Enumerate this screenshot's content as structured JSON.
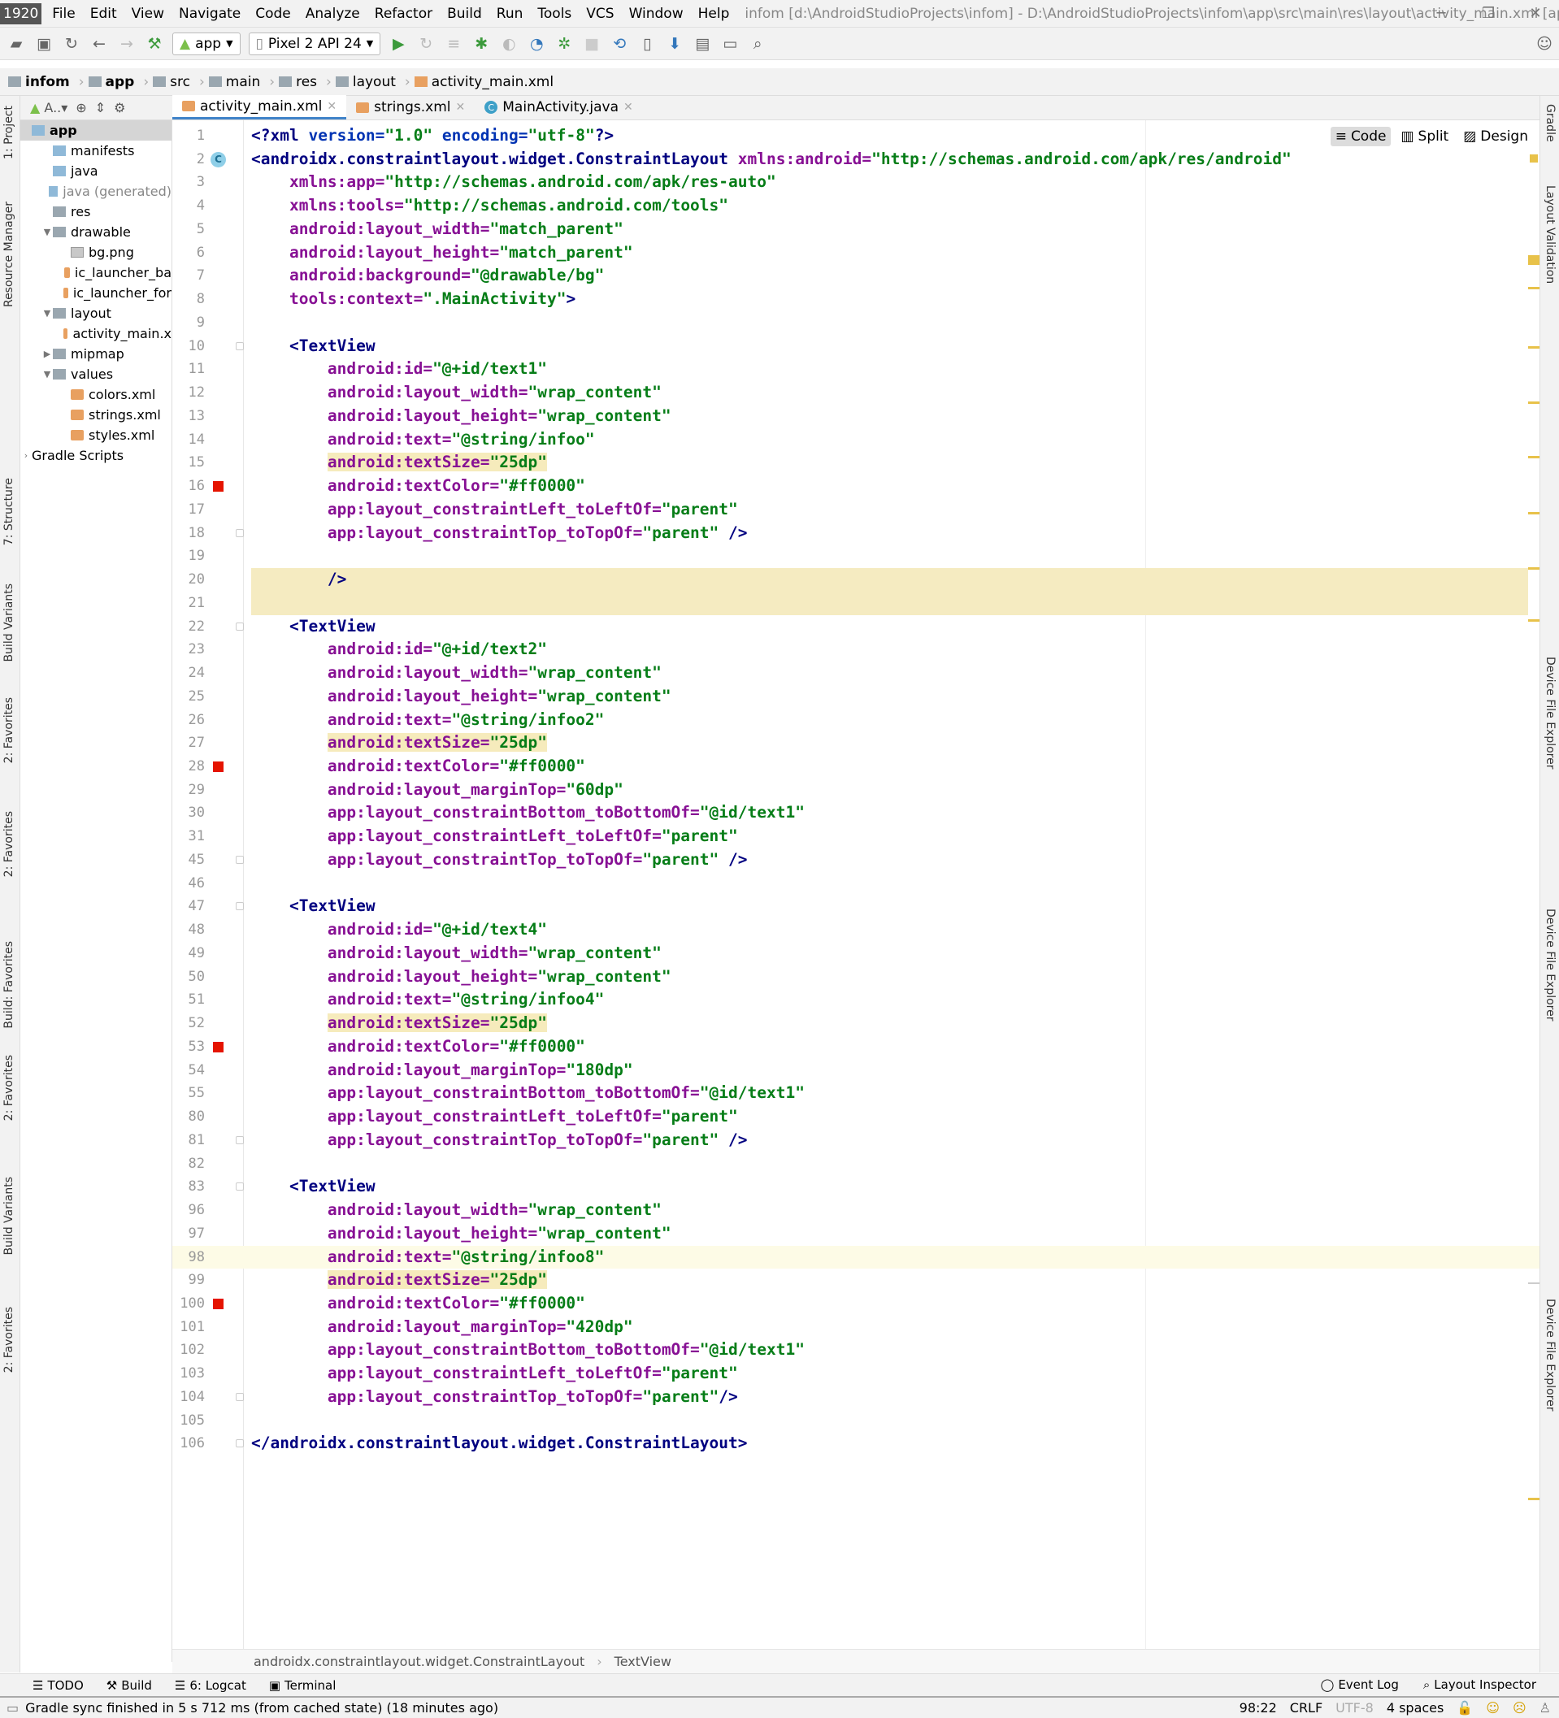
{
  "resolution_badge": "1920 × 1030",
  "menu": [
    "File",
    "Edit",
    "View",
    "Navigate",
    "Code",
    "Analyze",
    "Refactor",
    "Build",
    "Run",
    "Tools",
    "VCS",
    "Window",
    "Help"
  ],
  "window_title": "infom [d:\\AndroidStudioProjects\\infom] - D:\\AndroidStudioProjects\\infom\\app\\src\\main\\res\\layout\\activity_main.xml [app]",
  "toolbar": {
    "run_config": "app",
    "device": "Pixel 2 API 24"
  },
  "breadcrumb": [
    "infom",
    "app",
    "src",
    "main",
    "res",
    "layout",
    "activity_main.xml"
  ],
  "left_strip": [
    "1: Project",
    "Resource Manager",
    "7: Structure",
    "Build Variants",
    "2: Favorites",
    "2: Favorites",
    "Build: Favorites",
    "2: Favorites",
    "Build Variants",
    "2: Favorites"
  ],
  "right_strip": [
    "Gradle",
    "Layout Validation",
    "Device File Explorer",
    "Device File Explorer",
    "Device File Explorer"
  ],
  "project_panel": {
    "selector": "A..",
    "items": [
      {
        "label": "app",
        "level": 0,
        "icon": "folder",
        "arrow": "",
        "sel": true
      },
      {
        "label": "manifests",
        "level": 1,
        "icon": "folder",
        "arrow": ""
      },
      {
        "label": "java",
        "level": 1,
        "icon": "folder",
        "arrow": ""
      },
      {
        "label": "java (generated)",
        "level": 1,
        "icon": "folder",
        "arrow": "",
        "gen": true
      },
      {
        "label": "res",
        "level": 1,
        "icon": "gfolder",
        "arrow": ""
      },
      {
        "label": "drawable",
        "level": 1,
        "icon": "gfolder",
        "arrow": "▼"
      },
      {
        "label": "bg.png",
        "level": 2,
        "icon": "png",
        "arrow": ""
      },
      {
        "label": "ic_launcher_ba",
        "level": 2,
        "icon": "xml",
        "arrow": ""
      },
      {
        "label": "ic_launcher_for",
        "level": 2,
        "icon": "xml",
        "arrow": ""
      },
      {
        "label": "layout",
        "level": 1,
        "icon": "gfolder",
        "arrow": "▼"
      },
      {
        "label": "activity_main.x",
        "level": 2,
        "icon": "xml",
        "arrow": ""
      },
      {
        "label": "mipmap",
        "level": 1,
        "icon": "gfolder",
        "arrow": "▶"
      },
      {
        "label": "values",
        "level": 1,
        "icon": "gfolder",
        "arrow": "▼"
      },
      {
        "label": "colors.xml",
        "level": 2,
        "icon": "xml",
        "arrow": ""
      },
      {
        "label": "strings.xml",
        "level": 2,
        "icon": "xml",
        "arrow": ""
      },
      {
        "label": "styles.xml",
        "level": 2,
        "icon": "xml",
        "arrow": ""
      },
      {
        "label": "Gradle Scripts",
        "level": 0,
        "icon": "",
        "arrow": "›"
      }
    ]
  },
  "tabs": [
    {
      "label": "activity_main.xml",
      "icon": "xml",
      "active": true
    },
    {
      "label": "strings.xml",
      "icon": "xml",
      "active": false
    },
    {
      "label": "MainActivity.java",
      "icon": "class",
      "active": false
    }
  ],
  "view_modes": [
    "Code",
    "Split",
    "Design"
  ],
  "code_lines": [
    {
      "n": "1",
      "t": [
        [
          "tg",
          "<?xml "
        ],
        [
          "at2",
          "version="
        ],
        [
          "vl",
          "\"1.0\" "
        ],
        [
          "at2",
          "encoding="
        ],
        [
          "vl",
          "\"utf-8\""
        ],
        [
          "tg",
          "?>"
        ]
      ]
    },
    {
      "n": "2",
      "m": "c",
      "t": [
        [
          "tg",
          "<androidx.constraintlayout.widget.ConstraintLayout "
        ],
        [
          "at",
          "xmlns:android="
        ],
        [
          "vl",
          "\"http://schemas.android.com/apk/res/android\""
        ]
      ]
    },
    {
      "n": "3",
      "t": [
        [
          "pl",
          "    "
        ],
        [
          "at",
          "xmlns:app="
        ],
        [
          "vl",
          "\"http://schemas.android.com/apk/res-auto\""
        ]
      ]
    },
    {
      "n": "4",
      "t": [
        [
          "pl",
          "    "
        ],
        [
          "at",
          "xmlns:tools="
        ],
        [
          "vl",
          "\"http://schemas.android.com/tools\""
        ]
      ]
    },
    {
      "n": "5",
      "t": [
        [
          "pl",
          "    "
        ],
        [
          "at",
          "android:layout_width="
        ],
        [
          "vl",
          "\"match_parent\""
        ]
      ]
    },
    {
      "n": "6",
      "t": [
        [
          "pl",
          "    "
        ],
        [
          "at",
          "android:layout_height="
        ],
        [
          "vl",
          "\"match_parent\""
        ]
      ]
    },
    {
      "n": "7",
      "t": [
        [
          "pl",
          "    "
        ],
        [
          "at",
          "android:background="
        ],
        [
          "vl",
          "\"@drawable/bg\""
        ]
      ]
    },
    {
      "n": "8",
      "t": [
        [
          "pl",
          "    "
        ],
        [
          "at",
          "tools:context="
        ],
        [
          "vl",
          "\".MainActivity\""
        ],
        [
          "tg",
          ">"
        ]
      ]
    },
    {
      "n": "9",
      "t": []
    },
    {
      "n": "10",
      "f": 1,
      "t": [
        [
          "pl",
          "    "
        ],
        [
          "tg",
          "<TextView"
        ]
      ]
    },
    {
      "n": "11",
      "t": [
        [
          "pl",
          "        "
        ],
        [
          "at",
          "android:id="
        ],
        [
          "vl",
          "\"@+id/text1\""
        ]
      ]
    },
    {
      "n": "12",
      "t": [
        [
          "pl",
          "        "
        ],
        [
          "at",
          "android:layout_width="
        ],
        [
          "vl",
          "\"wrap_content\""
        ]
      ]
    },
    {
      "n": "13",
      "t": [
        [
          "pl",
          "        "
        ],
        [
          "at",
          "android:layout_height="
        ],
        [
          "vl",
          "\"wrap_content\""
        ]
      ]
    },
    {
      "n": "14",
      "t": [
        [
          "pl",
          "        "
        ],
        [
          "at",
          "android:text="
        ],
        [
          "vl",
          "\"@string/infoo\""
        ]
      ]
    },
    {
      "n": "15",
      "h": 1,
      "t": [
        [
          "pl",
          "        "
        ],
        [
          "at",
          "android:textSize="
        ],
        [
          "vl",
          "\"25dp\""
        ]
      ]
    },
    {
      "n": "16",
      "m": "r",
      "t": [
        [
          "pl",
          "        "
        ],
        [
          "at",
          "android:textColor="
        ],
        [
          "vl",
          "\"#ff0000\""
        ]
      ]
    },
    {
      "n": "17",
      "t": [
        [
          "pl",
          "        "
        ],
        [
          "at",
          "app:layout_constraintLeft_toLeftOf="
        ],
        [
          "vl",
          "\"parent\""
        ]
      ]
    },
    {
      "n": "18",
      "f": 1,
      "t": [
        [
          "pl",
          "        "
        ],
        [
          "at",
          "app:layout_constraintTop_toTopOf="
        ],
        [
          "vl",
          "\"parent\""
        ],
        [
          "tg",
          " />"
        ]
      ]
    },
    {
      "n": "19",
      "t": []
    },
    {
      "n": "20",
      "b": 1,
      "t": [
        [
          "pl",
          "        "
        ],
        [
          "tg",
          "/>"
        ]
      ]
    },
    {
      "n": "21",
      "b": 1,
      "t": []
    },
    {
      "n": "22",
      "f": 1,
      "t": [
        [
          "pl",
          "    "
        ],
        [
          "tg",
          "<TextView"
        ]
      ]
    },
    {
      "n": "23",
      "t": [
        [
          "pl",
          "        "
        ],
        [
          "at",
          "android:id="
        ],
        [
          "vl",
          "\"@+id/text2\""
        ]
      ]
    },
    {
      "n": "24",
      "t": [
        [
          "pl",
          "        "
        ],
        [
          "at",
          "android:layout_width="
        ],
        [
          "vl",
          "\"wrap_content\""
        ]
      ]
    },
    {
      "n": "25",
      "t": [
        [
          "pl",
          "        "
        ],
        [
          "at",
          "android:layout_height="
        ],
        [
          "vl",
          "\"wrap_content\""
        ]
      ]
    },
    {
      "n": "26",
      "t": [
        [
          "pl",
          "        "
        ],
        [
          "at",
          "android:text="
        ],
        [
          "vl",
          "\"@string/infoo2\""
        ]
      ]
    },
    {
      "n": "27",
      "h": 1,
      "t": [
        [
          "pl",
          "        "
        ],
        [
          "at",
          "android:textSize="
        ],
        [
          "vl",
          "\"25dp\""
        ]
      ]
    },
    {
      "n": "28",
      "m": "r",
      "t": [
        [
          "pl",
          "        "
        ],
        [
          "at",
          "android:textColor="
        ],
        [
          "vl",
          "\"#ff0000\""
        ]
      ]
    },
    {
      "n": "29",
      "t": [
        [
          "pl",
          "        "
        ],
        [
          "at",
          "android:layout_marginTop="
        ],
        [
          "vl",
          "\"60dp\""
        ]
      ]
    },
    {
      "n": "30",
      "t": [
        [
          "pl",
          "        "
        ],
        [
          "at",
          "app:layout_constraintBottom_toBottomOf="
        ],
        [
          "vl",
          "\"@id/text1\""
        ]
      ]
    },
    {
      "n": "31",
      "t": [
        [
          "pl",
          "        "
        ],
        [
          "at",
          "app:layout_constraintLeft_toLeftOf="
        ],
        [
          "vl",
          "\"parent\""
        ]
      ]
    },
    {
      "n": "45",
      "f": 1,
      "t": [
        [
          "pl",
          "        "
        ],
        [
          "at",
          "app:layout_constraintTop_toTopOf="
        ],
        [
          "vl",
          "\"parent\""
        ],
        [
          "tg",
          " />"
        ]
      ]
    },
    {
      "n": "46",
      "t": []
    },
    {
      "n": "47",
      "f": 1,
      "t": [
        [
          "pl",
          "    "
        ],
        [
          "tg",
          "<TextView"
        ]
      ]
    },
    {
      "n": "48",
      "t": [
        [
          "pl",
          "        "
        ],
        [
          "at",
          "android:id="
        ],
        [
          "vl",
          "\"@+id/text4\""
        ]
      ]
    },
    {
      "n": "49",
      "t": [
        [
          "pl",
          "        "
        ],
        [
          "at",
          "android:layout_width="
        ],
        [
          "vl",
          "\"wrap_content\""
        ]
      ]
    },
    {
      "n": "50",
      "t": [
        [
          "pl",
          "        "
        ],
        [
          "at",
          "android:layout_height="
        ],
        [
          "vl",
          "\"wrap_content\""
        ]
      ]
    },
    {
      "n": "51",
      "t": [
        [
          "pl",
          "        "
        ],
        [
          "at",
          "android:text="
        ],
        [
          "vl",
          "\"@string/infoo4\""
        ]
      ]
    },
    {
      "n": "52",
      "h": 1,
      "t": [
        [
          "pl",
          "        "
        ],
        [
          "at",
          "android:textSize="
        ],
        [
          "vl",
          "\"25dp\""
        ]
      ]
    },
    {
      "n": "53",
      "m": "r",
      "t": [
        [
          "pl",
          "        "
        ],
        [
          "at",
          "android:textColor="
        ],
        [
          "vl",
          "\"#ff0000\""
        ]
      ]
    },
    {
      "n": "54",
      "t": [
        [
          "pl",
          "        "
        ],
        [
          "at",
          "android:layout_marginTop="
        ],
        [
          "vl",
          "\"180dp\""
        ]
      ]
    },
    {
      "n": "55",
      "t": [
        [
          "pl",
          "        "
        ],
        [
          "at",
          "app:layout_constraintBottom_toBottomOf="
        ],
        [
          "vl",
          "\"@id/text1\""
        ]
      ]
    },
    {
      "n": "80",
      "t": [
        [
          "pl",
          "        "
        ],
        [
          "at",
          "app:layout_constraintLeft_toLeftOf="
        ],
        [
          "vl",
          "\"parent\""
        ]
      ]
    },
    {
      "n": "81",
      "f": 1,
      "t": [
        [
          "pl",
          "        "
        ],
        [
          "at",
          "app:layout_constraintTop_toTopOf="
        ],
        [
          "vl",
          "\"parent\""
        ],
        [
          "tg",
          " />"
        ]
      ]
    },
    {
      "n": "82",
      "t": []
    },
    {
      "n": "83",
      "f": 1,
      "t": [
        [
          "pl",
          "    "
        ],
        [
          "tg",
          "<TextView"
        ]
      ]
    },
    {
      "n": "96",
      "t": [
        [
          "pl",
          "        "
        ],
        [
          "at",
          "android:layout_width="
        ],
        [
          "vl",
          "\"wrap_content\""
        ]
      ]
    },
    {
      "n": "97",
      "t": [
        [
          "pl",
          "        "
        ],
        [
          "at",
          "android:layout_height="
        ],
        [
          "vl",
          "\"wrap_content\""
        ]
      ]
    },
    {
      "n": "98",
      "c": 1,
      "t": [
        [
          "pl",
          "        "
        ],
        [
          "at",
          "android:text="
        ],
        [
          "vl",
          "\"@string/infoo8\""
        ]
      ]
    },
    {
      "n": "99",
      "h": 1,
      "t": [
        [
          "pl",
          "        "
        ],
        [
          "at",
          "android:textSize="
        ],
        [
          "vl",
          "\"25dp\""
        ]
      ]
    },
    {
      "n": "100",
      "m": "r",
      "t": [
        [
          "pl",
          "        "
        ],
        [
          "at",
          "android:textColor="
        ],
        [
          "vl",
          "\"#ff0000\""
        ]
      ]
    },
    {
      "n": "101",
      "t": [
        [
          "pl",
          "        "
        ],
        [
          "at",
          "android:layout_marginTop="
        ],
        [
          "vl",
          "\"420dp\""
        ]
      ]
    },
    {
      "n": "102",
      "t": [
        [
          "pl",
          "        "
        ],
        [
          "at",
          "app:layout_constraintBottom_toBottomOf="
        ],
        [
          "vl",
          "\"@id/text1\""
        ]
      ]
    },
    {
      "n": "103",
      "t": [
        [
          "pl",
          "        "
        ],
        [
          "at",
          "app:layout_constraintLeft_toLeftOf="
        ],
        [
          "vl",
          "\"parent\""
        ]
      ]
    },
    {
      "n": "104",
      "f": 1,
      "t": [
        [
          "pl",
          "        "
        ],
        [
          "at",
          "app:layout_constraintTop_toTopOf="
        ],
        [
          "vl",
          "\"parent\""
        ],
        [
          "tg",
          "/>"
        ]
      ]
    },
    {
      "n": "105",
      "t": []
    },
    {
      "n": "106",
      "f": 1,
      "t": [
        [
          "tg",
          "</androidx.constraintlayout.widget.ConstraintLayout>"
        ]
      ]
    }
  ],
  "editor_breadcrumb": [
    "androidx.constraintlayout.widget.ConstraintLayout",
    "TextView"
  ],
  "bottom_tools": [
    "TODO",
    "Build",
    "6: Logcat",
    "Terminal"
  ],
  "bottom_right_tools": [
    "Event Log",
    "Layout Inspector"
  ],
  "status": {
    "message": "Gradle sync finished in 5 s 712 ms (from cached state) (18 minutes ago)",
    "position": "98:22",
    "line_sep": "CRLF",
    "encoding": "UTF-8",
    "indent": "4 spaces"
  },
  "colors": {
    "tag": "#000080",
    "attribute": "#871094",
    "value": "#067d17",
    "accent": "#4083c9",
    "error_marker": "#e51400"
  }
}
